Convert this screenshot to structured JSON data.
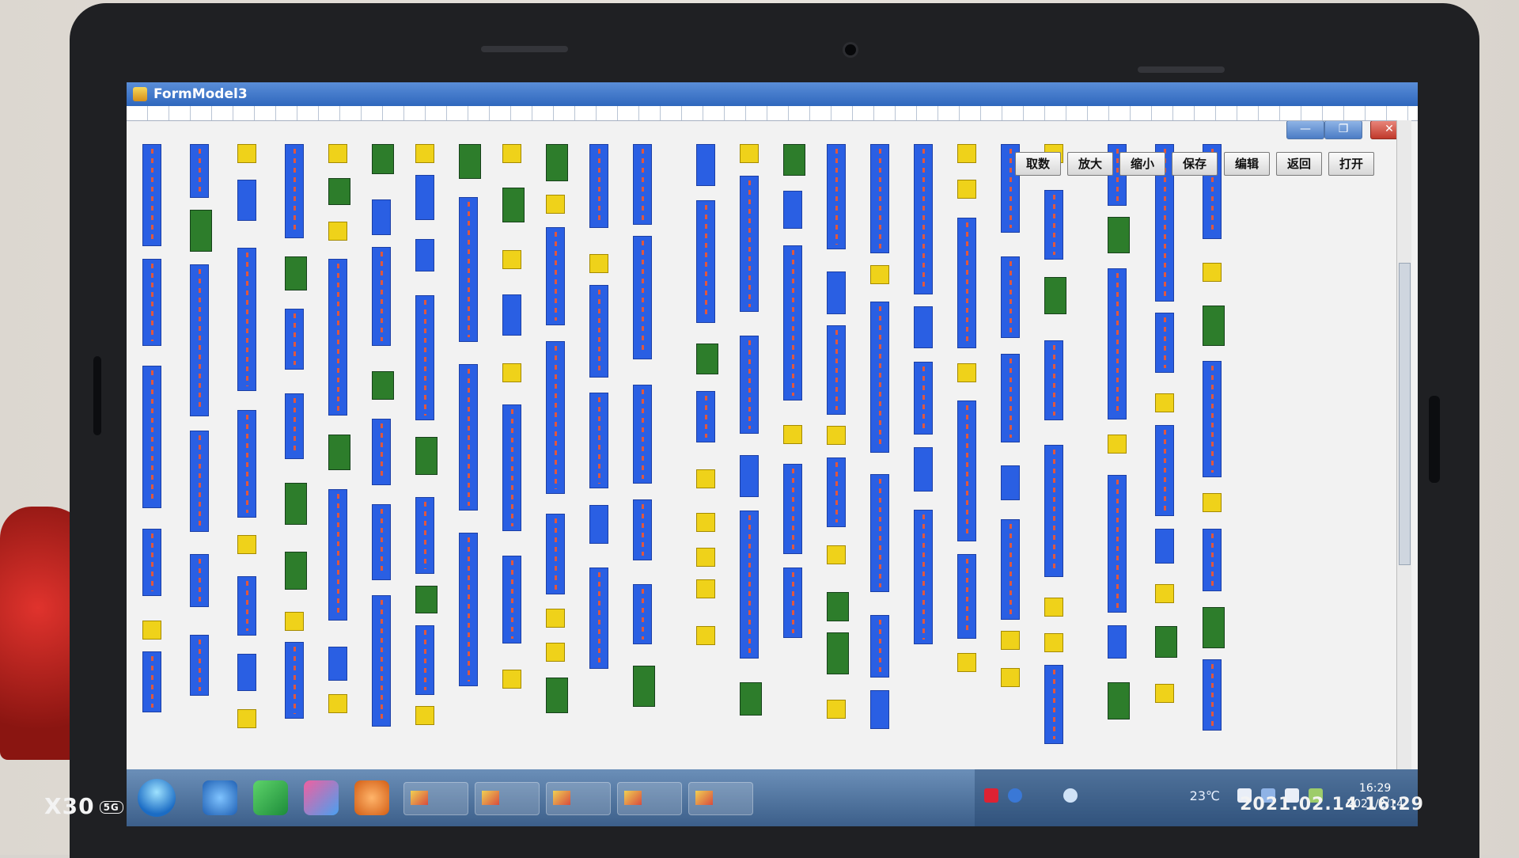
{
  "window": {
    "title": "FormModel3",
    "controls": {
      "minimize": "—",
      "maximize": "❐",
      "close": "✕"
    }
  },
  "toolbar": {
    "buttons": [
      "取数",
      "放大",
      "缩小",
      "保存",
      "编辑",
      "返回",
      "打开"
    ]
  },
  "taskbar": {
    "temperature": "23℃",
    "clock_time": "16:29",
    "clock_date": "2021/2/14"
  },
  "photo_watermark": {
    "device": "X30",
    "network": "5G",
    "datetime": "2021.02.14 16:29"
  },
  "colors": {
    "block_blue": "#2a5fe3",
    "block_yellow": "#efd21a",
    "block_green": "#2d7d2b"
  }
}
